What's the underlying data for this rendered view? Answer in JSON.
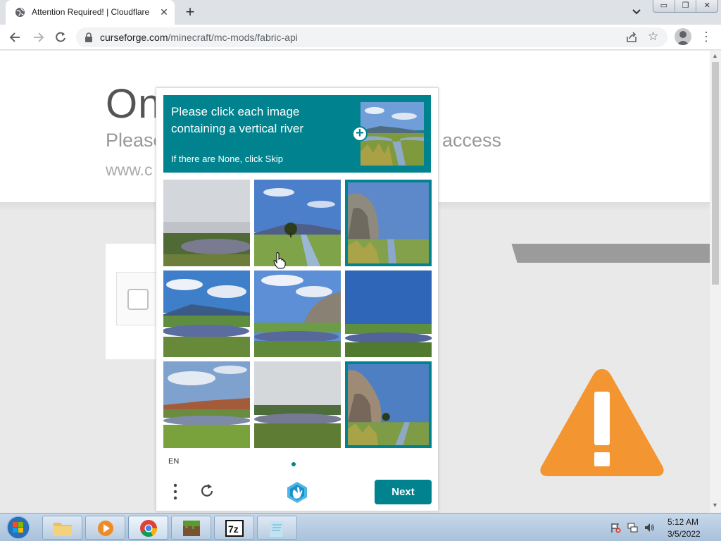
{
  "browser": {
    "tab_title": "Attention Required! | Cloudflare",
    "tab_close": "✕",
    "new_tab": "+",
    "url_host": "curseforge.com",
    "url_path": "/minecraft/mc-mods/fabric-api",
    "icons": [
      "globe-icon",
      "back-icon",
      "forward-icon",
      "reload-icon",
      "lock-icon",
      "share-icon",
      "star-icon",
      "profile-icon",
      "menu-icon"
    ]
  },
  "window": {
    "minimize": "▭",
    "restore": "❐",
    "close": "✕"
  },
  "background_page": {
    "heading_fragment": "On",
    "subtitle_fragment": "Please",
    "subtitle_end": "access",
    "domain_fragment": "www.c"
  },
  "captcha": {
    "prompt_line": "Please click each image containing a vertical river",
    "skip_hint": "If there are None, click Skip",
    "example_plus": "+",
    "language": "EN",
    "next_label": "Next",
    "accent_color": "#00838f",
    "tiles": [
      {
        "scene": "lake-overcast",
        "selected": false
      },
      {
        "scene": "river-tree-mountain",
        "selected": false
      },
      {
        "scene": "river-cliff",
        "selected": true
      },
      {
        "scene": "lake-mountain",
        "selected": false
      },
      {
        "scene": "lake-cliff",
        "selected": false
      },
      {
        "scene": "lake-blue-sky",
        "selected": false
      },
      {
        "scene": "lake-autumn-trees",
        "selected": false
      },
      {
        "scene": "lake-haze",
        "selected": false
      },
      {
        "scene": "river-cliff-tree",
        "selected": true
      }
    ]
  },
  "taskbar": {
    "apps": [
      "explorer",
      "media-player",
      "chrome",
      "minecraft",
      "7zip",
      "notepad"
    ],
    "clock_time": "5:12 AM",
    "clock_date": "3/5/2022"
  },
  "colors": {
    "warning": "#f39530",
    "teal": "#00838f"
  }
}
